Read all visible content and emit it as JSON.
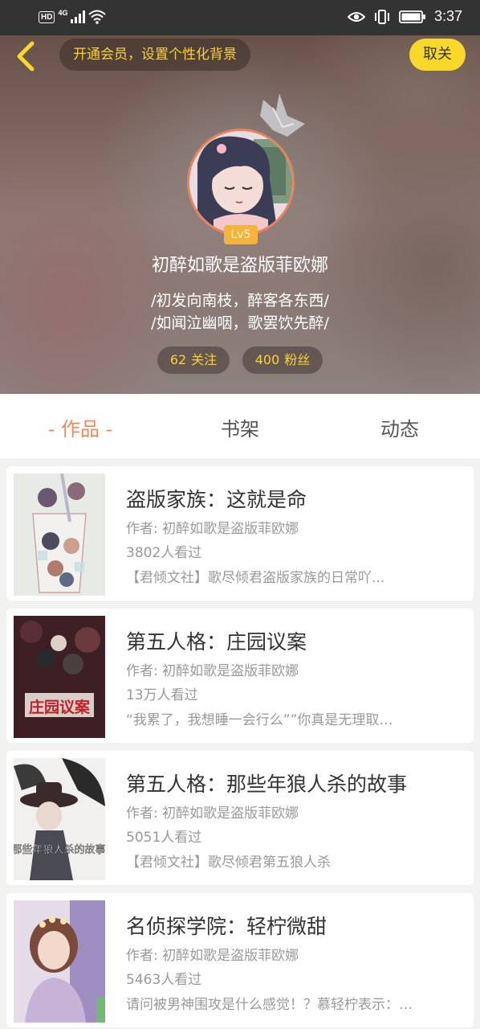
{
  "status_bar": {
    "hd_label": "HD",
    "network_label": "4G",
    "time": "3:37"
  },
  "header": {
    "back_icon": "chevron-left-icon",
    "vip_prompt": "开通会员，设置个性化背景",
    "cancel_label": "取关"
  },
  "profile": {
    "level": "Lv5",
    "username": "初醉如歌是盗版菲欧娜",
    "bio_line1": "/初发向南枝，醉客各东西/",
    "bio_line2": "/如闻泣幽咽，歌罢饮先醉/",
    "following_count": "62",
    "following_label": "关注",
    "fans_count": "400",
    "fans_label": "粉丝"
  },
  "tabs": [
    {
      "label": "- 作品 -",
      "active": true
    },
    {
      "label": "书架",
      "active": false
    },
    {
      "label": "动态",
      "active": false
    }
  ],
  "works": [
    {
      "title": "盗版家族：这就是命",
      "author": "作者: 初醉如歌是盗版菲欧娜",
      "views": "3802人看过",
      "desc": "【君倾文社】歌尽倾君盗版家族的日常吖..."
    },
    {
      "title": "第五人格：庄园议案",
      "author": "作者: 初醉如歌是盗版菲欧娜",
      "views": "13万人看过",
      "desc": "“我累了，我想睡一会行么””你真是无理取…",
      "cover_text": "庄园议案"
    },
    {
      "title": "第五人格：那些年狼人杀的故事",
      "author": "作者: 初醉如歌是盗版菲欧娜",
      "views": "5051人看过",
      "desc": "【君倾文社】歌尽倾君第五狼人杀",
      "cover_text": "那些年狼人杀的故事"
    },
    {
      "title": "名侦探学院：轻柠微甜",
      "author": "作者: 初醉如歌是盗版菲欧娜",
      "views": "5463人看过",
      "desc": "请问被男神围攻是什么感觉！？慕轻柠表示：…"
    }
  ],
  "colors": {
    "accent_orange": "#ee8a5c",
    "accent_yellow": "#f8d92a",
    "level_badge": "#f3b33c"
  }
}
